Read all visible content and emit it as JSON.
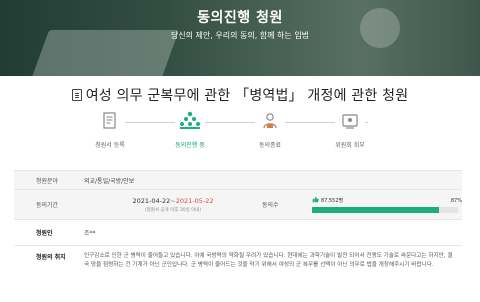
{
  "banner": {
    "title": "동의진행 청원",
    "subtitle": "당신의 제안, 우리의 동의, 함께 하는 입법"
  },
  "petition": {
    "title": "여성 의무 군복무에 관한 「병역법」 개정에 관한 청원"
  },
  "steps": [
    {
      "label": "청원서 등록",
      "icon": "document-register-icon"
    },
    {
      "label": "동의진행 중",
      "icon": "people-group-icon"
    },
    {
      "label": "동의종료",
      "icon": "person-icon"
    },
    {
      "label": "위원회 회부",
      "icon": "committee-icon"
    }
  ],
  "info": {
    "category_label": "청원분야",
    "category_value": "외교/통일/국방/안보",
    "period_label": "동의기간",
    "period_start": "2021-04-22",
    "period_sep": "~",
    "period_end": "2021-05-22",
    "period_note": "(청원서 공개 이후 30일 이내)",
    "votes_label": "동의수",
    "votes_count": "87,552명",
    "votes_percent_text": "87%",
    "votes_percent": 87,
    "petitioner_label": "청원인",
    "petitioner_value": "조**",
    "purpose_label": "청원의 취지",
    "purpose_text": "인구감소로 인한 군 병력이 줄어들고 있습니다. 이에 국방력의 약화될 우려가 있습니다. 현대에는 과학기술이 발전 되어서 전쟁도 기술로 싸운다고는 하지만, 결국 땅을 점령하는 건 기계가 아닌 군인입니다. 군 병력이 줄어드는 것을 막기 위해서 여성의 군 복무를 선택이 아닌 의무로 법을 개정해주시기 바랍니다."
  },
  "colors": {
    "accent_green": "#1bb07b",
    "end_date_red": "#d94b3d"
  }
}
